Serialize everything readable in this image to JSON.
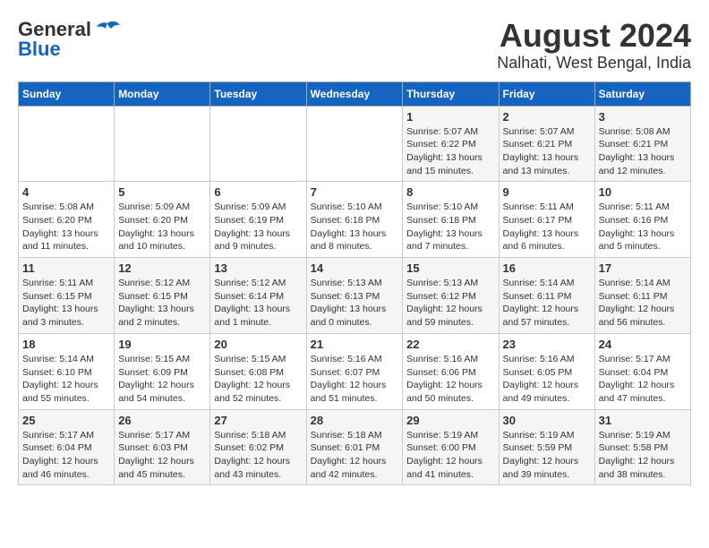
{
  "logo": {
    "line1": "General",
    "line2": "Blue"
  },
  "title": "August 2024",
  "subtitle": "Nalhati, West Bengal, India",
  "days_header": [
    "Sunday",
    "Monday",
    "Tuesday",
    "Wednesday",
    "Thursday",
    "Friday",
    "Saturday"
  ],
  "weeks": [
    [
      {
        "day": "",
        "info": ""
      },
      {
        "day": "",
        "info": ""
      },
      {
        "day": "",
        "info": ""
      },
      {
        "day": "",
        "info": ""
      },
      {
        "day": "1",
        "info": "Sunrise: 5:07 AM\nSunset: 6:22 PM\nDaylight: 13 hours and 15 minutes."
      },
      {
        "day": "2",
        "info": "Sunrise: 5:07 AM\nSunset: 6:21 PM\nDaylight: 13 hours and 13 minutes."
      },
      {
        "day": "3",
        "info": "Sunrise: 5:08 AM\nSunset: 6:21 PM\nDaylight: 13 hours and 12 minutes."
      }
    ],
    [
      {
        "day": "4",
        "info": "Sunrise: 5:08 AM\nSunset: 6:20 PM\nDaylight: 13 hours and 11 minutes."
      },
      {
        "day": "5",
        "info": "Sunrise: 5:09 AM\nSunset: 6:20 PM\nDaylight: 13 hours and 10 minutes."
      },
      {
        "day": "6",
        "info": "Sunrise: 5:09 AM\nSunset: 6:19 PM\nDaylight: 13 hours and 9 minutes."
      },
      {
        "day": "7",
        "info": "Sunrise: 5:10 AM\nSunset: 6:18 PM\nDaylight: 13 hours and 8 minutes."
      },
      {
        "day": "8",
        "info": "Sunrise: 5:10 AM\nSunset: 6:18 PM\nDaylight: 13 hours and 7 minutes."
      },
      {
        "day": "9",
        "info": "Sunrise: 5:11 AM\nSunset: 6:17 PM\nDaylight: 13 hours and 6 minutes."
      },
      {
        "day": "10",
        "info": "Sunrise: 5:11 AM\nSunset: 6:16 PM\nDaylight: 13 hours and 5 minutes."
      }
    ],
    [
      {
        "day": "11",
        "info": "Sunrise: 5:11 AM\nSunset: 6:15 PM\nDaylight: 13 hours and 3 minutes."
      },
      {
        "day": "12",
        "info": "Sunrise: 5:12 AM\nSunset: 6:15 PM\nDaylight: 13 hours and 2 minutes."
      },
      {
        "day": "13",
        "info": "Sunrise: 5:12 AM\nSunset: 6:14 PM\nDaylight: 13 hours and 1 minute."
      },
      {
        "day": "14",
        "info": "Sunrise: 5:13 AM\nSunset: 6:13 PM\nDaylight: 13 hours and 0 minutes."
      },
      {
        "day": "15",
        "info": "Sunrise: 5:13 AM\nSunset: 6:12 PM\nDaylight: 12 hours and 59 minutes."
      },
      {
        "day": "16",
        "info": "Sunrise: 5:14 AM\nSunset: 6:11 PM\nDaylight: 12 hours and 57 minutes."
      },
      {
        "day": "17",
        "info": "Sunrise: 5:14 AM\nSunset: 6:11 PM\nDaylight: 12 hours and 56 minutes."
      }
    ],
    [
      {
        "day": "18",
        "info": "Sunrise: 5:14 AM\nSunset: 6:10 PM\nDaylight: 12 hours and 55 minutes."
      },
      {
        "day": "19",
        "info": "Sunrise: 5:15 AM\nSunset: 6:09 PM\nDaylight: 12 hours and 54 minutes."
      },
      {
        "day": "20",
        "info": "Sunrise: 5:15 AM\nSunset: 6:08 PM\nDaylight: 12 hours and 52 minutes."
      },
      {
        "day": "21",
        "info": "Sunrise: 5:16 AM\nSunset: 6:07 PM\nDaylight: 12 hours and 51 minutes."
      },
      {
        "day": "22",
        "info": "Sunrise: 5:16 AM\nSunset: 6:06 PM\nDaylight: 12 hours and 50 minutes."
      },
      {
        "day": "23",
        "info": "Sunrise: 5:16 AM\nSunset: 6:05 PM\nDaylight: 12 hours and 49 minutes."
      },
      {
        "day": "24",
        "info": "Sunrise: 5:17 AM\nSunset: 6:04 PM\nDaylight: 12 hours and 47 minutes."
      }
    ],
    [
      {
        "day": "25",
        "info": "Sunrise: 5:17 AM\nSunset: 6:04 PM\nDaylight: 12 hours and 46 minutes."
      },
      {
        "day": "26",
        "info": "Sunrise: 5:17 AM\nSunset: 6:03 PM\nDaylight: 12 hours and 45 minutes."
      },
      {
        "day": "27",
        "info": "Sunrise: 5:18 AM\nSunset: 6:02 PM\nDaylight: 12 hours and 43 minutes."
      },
      {
        "day": "28",
        "info": "Sunrise: 5:18 AM\nSunset: 6:01 PM\nDaylight: 12 hours and 42 minutes."
      },
      {
        "day": "29",
        "info": "Sunrise: 5:19 AM\nSunset: 6:00 PM\nDaylight: 12 hours and 41 minutes."
      },
      {
        "day": "30",
        "info": "Sunrise: 5:19 AM\nSunset: 5:59 PM\nDaylight: 12 hours and 39 minutes."
      },
      {
        "day": "31",
        "info": "Sunrise: 5:19 AM\nSunset: 5:58 PM\nDaylight: 12 hours and 38 minutes."
      }
    ]
  ]
}
